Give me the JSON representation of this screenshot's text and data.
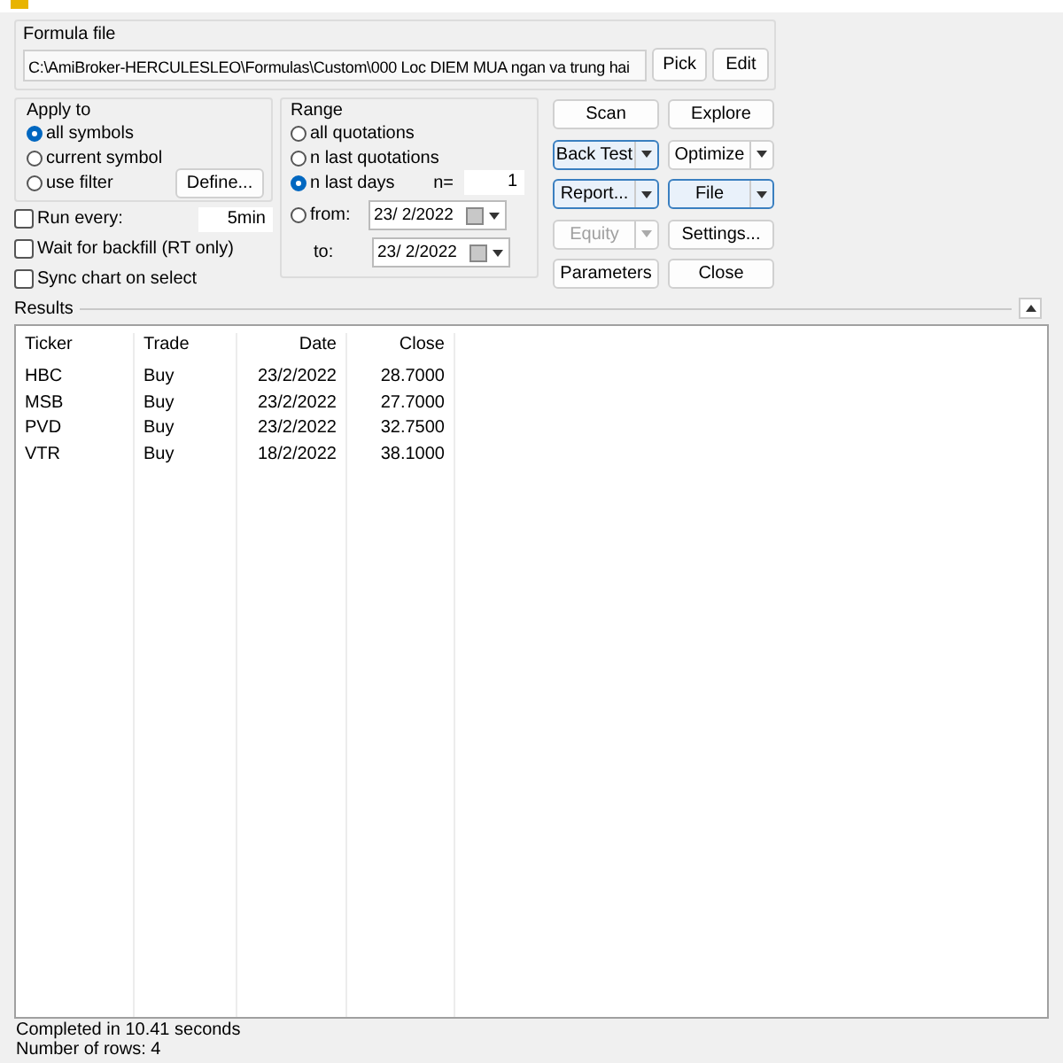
{
  "formula_file": {
    "label": "Formula file",
    "path": "C:\\AmiBroker-HERCULESLEO\\Formulas\\Custom\\000 Loc DIEM MUA ngan va trung hai",
    "buttons": [
      "Pick",
      "Edit"
    ]
  },
  "apply_to": {
    "label": "Apply to",
    "options": [
      {
        "label": "all symbols",
        "selected": true
      },
      {
        "label": "current symbol",
        "selected": false
      },
      {
        "label": "use filter",
        "selected": false
      }
    ],
    "define_button": "Define..."
  },
  "options": [
    {
      "kind": "interval",
      "label": "Run every:",
      "checked": false,
      "value": "5min"
    },
    {
      "kind": "check",
      "label": "Wait for backfill (RT only)",
      "checked": false
    },
    {
      "kind": "check",
      "label": "Sync chart on select",
      "checked": false
    }
  ],
  "range": {
    "label": "Range",
    "options": [
      {
        "label": "all quotations",
        "selected": false
      },
      {
        "label": "n last quotations",
        "selected": false
      },
      {
        "label": "n last days",
        "selected": true
      },
      {
        "label": "from:",
        "selected": false
      }
    ],
    "n_label": "n=",
    "n_value": "1",
    "from_date": "23/  2/2022",
    "to_label": "to:",
    "to_date": "23/  2/2022"
  },
  "actions": [
    {
      "label": "Scan",
      "split": false,
      "highlighted": false,
      "disabled": false
    },
    {
      "label": "Explore",
      "split": false,
      "highlighted": false,
      "disabled": false
    },
    {
      "label": "Back Test",
      "split": true,
      "highlighted": true,
      "disabled": false
    },
    {
      "label": "Optimize",
      "split": true,
      "highlighted": false,
      "disabled": false
    },
    {
      "label": "Report...",
      "split": true,
      "highlighted": true,
      "disabled": false
    },
    {
      "label": "File",
      "split": true,
      "highlighted": true,
      "disabled": false
    },
    {
      "label": "Equity",
      "split": true,
      "highlighted": false,
      "disabled": true
    },
    {
      "label": "Settings...",
      "split": false,
      "highlighted": false,
      "disabled": false
    },
    {
      "label": "Parameters",
      "split": false,
      "highlighted": false,
      "disabled": false
    },
    {
      "label": "Close",
      "split": false,
      "highlighted": false,
      "disabled": false
    }
  ],
  "results": {
    "label": "Results",
    "columns": [
      {
        "label": "Ticker",
        "kind": "text"
      },
      {
        "label": "Trade",
        "kind": "text"
      },
      {
        "label": "Date",
        "kind": "number"
      },
      {
        "label": "Close",
        "kind": "number"
      }
    ],
    "rows": [
      [
        "HBC",
        "Buy",
        "23/2/2022",
        "28.7000"
      ],
      [
        "MSB",
        "Buy",
        "23/2/2022",
        "27.7000"
      ],
      [
        "PVD",
        "Buy",
        "23/2/2022",
        "32.7500"
      ],
      [
        "VTR",
        "Buy",
        "18/2/2022",
        "38.1000"
      ]
    ]
  },
  "status_bar": [
    "Completed in 10.41 seconds",
    "Number of rows: 4"
  ]
}
